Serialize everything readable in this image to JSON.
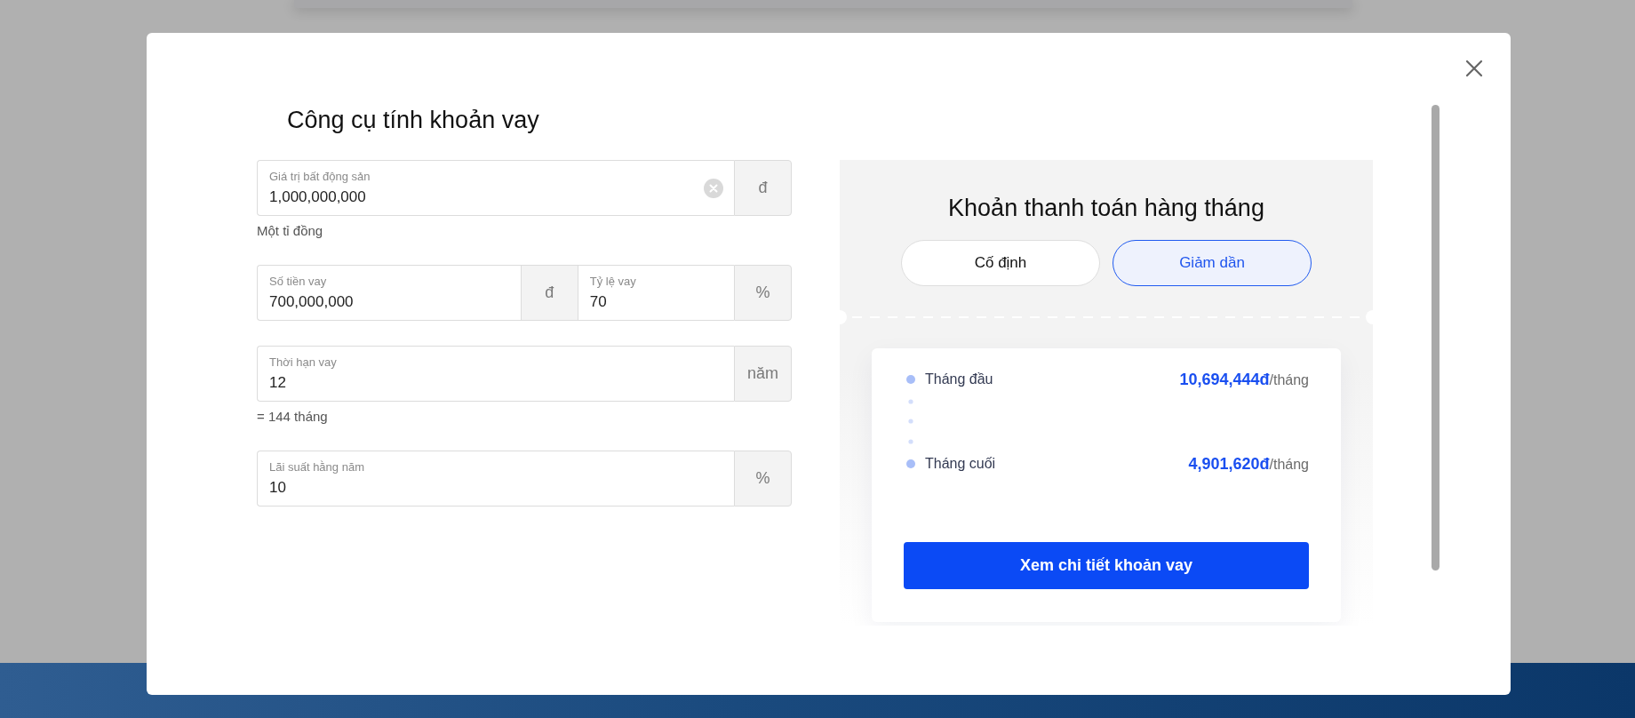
{
  "dialog": {
    "title": "Công cụ tính khoản vay"
  },
  "field_rows": [
    {
      "fields": [
        {
          "label": "Giá trị bất động sản",
          "value": "1,000,000,000",
          "unit": "đ",
          "clearable": true
        }
      ],
      "helper": "Một tỉ đồng"
    },
    {
      "fields": [
        {
          "label": "Số tiền vay",
          "value": "700,000,000",
          "unit": "đ",
          "clearable": false
        },
        {
          "label": "Tỷ lệ vay",
          "value": "70",
          "unit": "%",
          "clearable": false
        }
      ]
    },
    {
      "fields": [
        {
          "label": "Thời hạn vay",
          "value": "12",
          "unit": "năm",
          "clearable": false
        }
      ],
      "helper": "= 144 tháng"
    },
    {
      "fields": [
        {
          "label": "Lãi suất hằng năm",
          "value": "10",
          "unit": "%",
          "clearable": false
        }
      ]
    }
  ],
  "payment": {
    "title": "Khoản thanh toán hàng tháng",
    "modes": [
      {
        "label": "Cố định",
        "selected": false
      },
      {
        "label": "Giảm dần",
        "selected": true
      }
    ],
    "rows": [
      {
        "label": "Tháng đầu",
        "amount": "10,694,444đ",
        "unit": "/tháng"
      },
      {
        "label": "Tháng cuối",
        "amount": "4,901,620đ",
        "unit": "/tháng"
      }
    ],
    "action": "Xem chi tiết khoản vay"
  }
}
